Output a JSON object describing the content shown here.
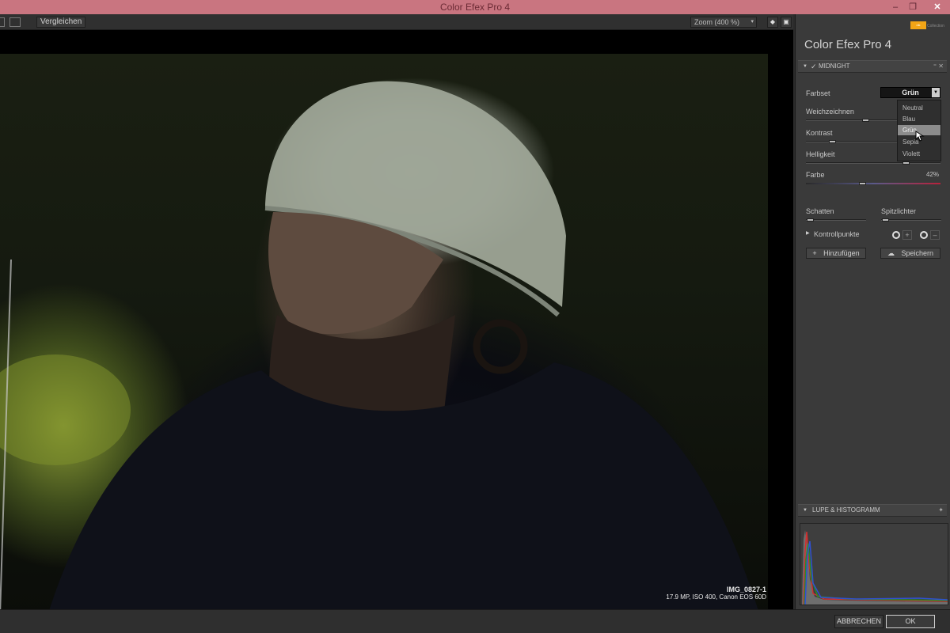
{
  "window": {
    "title": "Color Efex Pro 4",
    "minimize": "–",
    "maximize": "❐",
    "close": "✕"
  },
  "toolbar": {
    "compare_label": "Vergleichen",
    "zoom_label": "Zoom (400 %)",
    "zoom_arrow": "▾"
  },
  "image": {
    "filename": "IMG_0827-1",
    "meta": "17.9 MP, ISO 400, Canon EOS 60D"
  },
  "brand": {
    "badge": "nik",
    "sub": "Collection"
  },
  "panel": {
    "app_title": "Color Efex Pro",
    "app_version": "4",
    "filter": {
      "name": "MIDNIGHT",
      "check": "✓",
      "controls": "⁼ ✕"
    },
    "farbset": {
      "label": "Farbset",
      "selected": "Grün",
      "options": [
        "Neutral",
        "Blau",
        "Grün",
        "Sepia",
        "Violett"
      ]
    },
    "sliders": {
      "weichzeichnen": {
        "label": "Weichzeichnen",
        "level": 0.44
      },
      "kontrast": {
        "label": "Kontrast",
        "level": 0.2
      },
      "helligkeit": {
        "label": "Helligkeit",
        "level": 0.74
      },
      "farbe": {
        "label": "Farbe",
        "value": "42%",
        "level": 0.42
      },
      "schatten": {
        "label": "Schatten",
        "level": 0.05
      },
      "spitzlichter": {
        "label": "Spitzlichter",
        "level": 0.05
      }
    },
    "kontrollpunkte": {
      "label": "Kontrollpunkte",
      "plus": "+",
      "minus": "–"
    },
    "add_label": "Hinzufügen",
    "add_icon": "+",
    "save_label": "Speichern",
    "histogram": {
      "title": "LUPE & HISTOGRAMM"
    }
  },
  "footer": {
    "cancel_label": "ABBRECHEN",
    "ok_label": "OK"
  },
  "colors": {
    "titlebar": "#c97580",
    "panel": "#3a3a3a",
    "accent_orange": "#f2a516"
  }
}
